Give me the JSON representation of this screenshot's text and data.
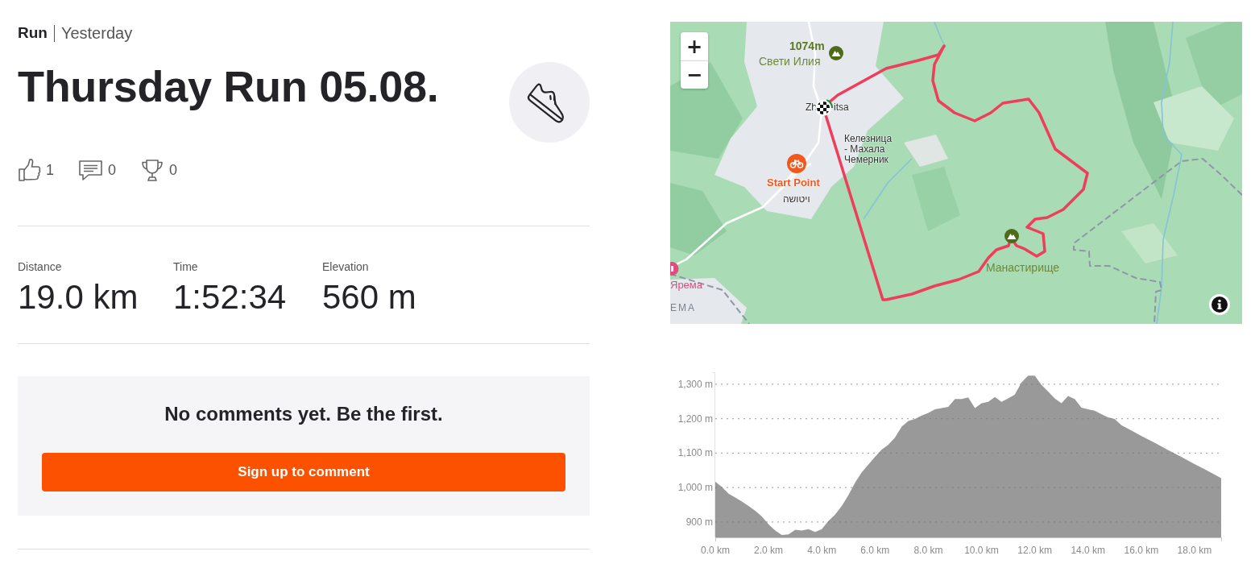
{
  "header": {
    "activity_type": "Run",
    "date": "Yesterday"
  },
  "title": "Thursday Run 05.08.",
  "social": [
    {
      "kind": "kudos",
      "count": "1"
    },
    {
      "kind": "comments",
      "count": "0"
    },
    {
      "kind": "achievements",
      "count": "0"
    }
  ],
  "stats": [
    {
      "label": "Distance",
      "value": "19.0 km"
    },
    {
      "label": "Time",
      "value": "1:52:34"
    },
    {
      "label": "Elevation",
      "value": "560 m"
    }
  ],
  "comments": {
    "empty_message": "No comments yet. Be the first.",
    "button": "Sign up to comment"
  },
  "map": {
    "zoom_controls": [
      {
        "kind": "zoom_in",
        "label": "+"
      },
      {
        "kind": "zoom_out",
        "label": "−"
      }
    ],
    "labels": [
      {
        "kind": "peak_height",
        "text": "1074m"
      },
      {
        "kind": "peak_name",
        "text": "Свети Илия"
      },
      {
        "kind": "place",
        "text": "Zh"
      },
      {
        "kind": "place",
        "text": "itsa"
      },
      {
        "kind": "place",
        "text": "Келезница"
      },
      {
        "kind": "place",
        "text": "- Махала"
      },
      {
        "kind": "place",
        "text": "Чемерник"
      },
      {
        "kind": "start",
        "text": "Start Point"
      },
      {
        "kind": "place",
        "text": "ויטושה"
      },
      {
        "kind": "peak_name",
        "text": "Манастирище"
      },
      {
        "kind": "town",
        "text": "Ярема"
      },
      {
        "kind": "region",
        "text": "ЕМА"
      }
    ]
  },
  "elevation": {
    "chart_data": {
      "type": "area",
      "x": [
        0,
        0.25,
        0.5,
        0.75,
        1,
        1.25,
        1.5,
        1.75,
        2,
        2.25,
        2.5,
        2.75,
        3,
        3.25,
        3.5,
        3.75,
        4,
        4.25,
        4.5,
        4.75,
        5,
        5.25,
        5.5,
        5.75,
        6,
        6.25,
        6.5,
        6.75,
        7,
        7.25,
        7.5,
        7.75,
        8,
        8.25,
        8.5,
        8.75,
        9,
        9.25,
        9.5,
        9.75,
        10,
        10.25,
        10.5,
        10.75,
        11,
        11.25,
        11.5,
        11.75,
        12,
        12.25,
        12.5,
        12.75,
        13,
        13.25,
        13.5,
        13.75,
        14,
        14.25,
        14.5,
        14.75,
        15,
        15.25,
        15.5,
        16,
        16.5,
        17,
        17.5,
        18,
        18.5,
        19
      ],
      "values": [
        1017,
        1001,
        982,
        971,
        959,
        946,
        932,
        916,
        893,
        875,
        862,
        864,
        877,
        875,
        879,
        871,
        879,
        903,
        921,
        946,
        978,
        1014,
        1044,
        1067,
        1089,
        1110,
        1124,
        1145,
        1177,
        1193,
        1199,
        1209,
        1217,
        1227,
        1231,
        1234,
        1257,
        1257,
        1262,
        1231,
        1245,
        1249,
        1263,
        1249,
        1259,
        1270,
        1305,
        1325,
        1325,
        1298,
        1279,
        1259,
        1245,
        1266,
        1257,
        1232,
        1227,
        1223,
        1213,
        1204,
        1199,
        1181,
        1171,
        1150,
        1130,
        1109,
        1089,
        1068,
        1048,
        1027
      ],
      "xlim": [
        0,
        19
      ],
      "ylim": [
        855,
        1335
      ],
      "grid": true,
      "xticks": [
        {
          "value": 0,
          "label": "0.0 km"
        },
        {
          "value": 2,
          "label": "2.0 km"
        },
        {
          "value": 4,
          "label": "4.0 km"
        },
        {
          "value": 6,
          "label": "6.0 km"
        },
        {
          "value": 8,
          "label": "8.0 km"
        },
        {
          "value": 10,
          "label": "10.0 km"
        },
        {
          "value": 12,
          "label": "12.0 km"
        },
        {
          "value": 14,
          "label": "14.0 km"
        },
        {
          "value": 16,
          "label": "16.0 km"
        },
        {
          "value": 18,
          "label": "18.0 km"
        }
      ],
      "yticks": [
        {
          "value": 900,
          "label": "900 m"
        },
        {
          "value": 1000,
          "label": "1,000 m"
        },
        {
          "value": 1100,
          "label": "1,100 m"
        },
        {
          "value": 1200,
          "label": "1,200 m"
        },
        {
          "value": 1300,
          "label": "1,300 m"
        }
      ]
    }
  }
}
